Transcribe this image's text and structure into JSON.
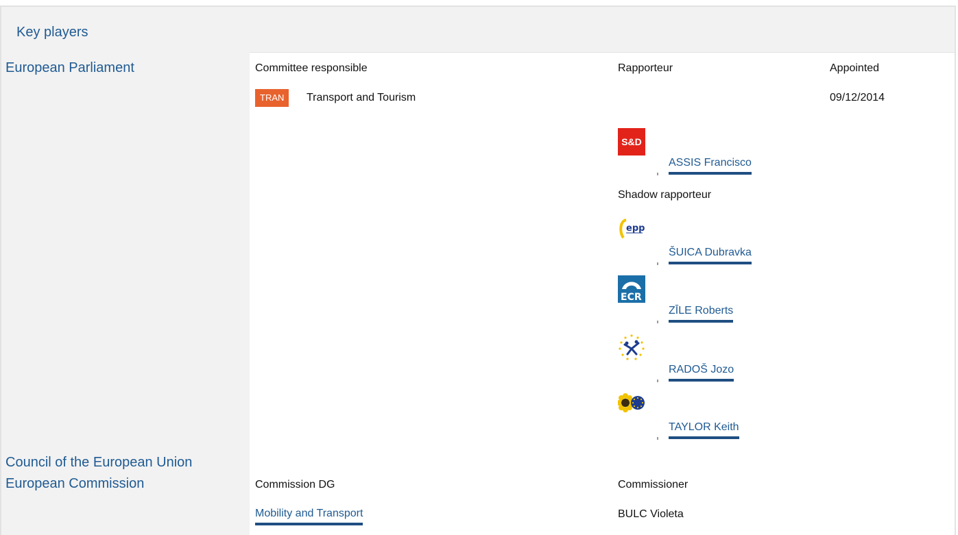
{
  "section": {
    "title": "Key players"
  },
  "institutions": {
    "parliament": "European Parliament",
    "council": "Council of the European Union",
    "commission": "European Commission"
  },
  "parliament": {
    "committee_header": "Committee responsible",
    "rapporteur_header": "Rapporteur",
    "appointed_header": "Appointed",
    "committee_badge": "TRAN",
    "committee_name": "Transport and Tourism",
    "appointed_date": "09/12/2014",
    "rapporteur": {
      "name": "ASSIS Francisco",
      "group_logo_text": "S&D"
    },
    "shadow_header": "Shadow rapporteur",
    "shadows": [
      {
        "name": "ŠUICA Dubravka",
        "group_logo_text": "epp"
      },
      {
        "name": "ZĪLE Roberts",
        "group_logo_text": "ECR"
      },
      {
        "name": "RADOŠ Jozo",
        "group_logo_text": ""
      },
      {
        "name": "TAYLOR Keith",
        "group_logo_text": ""
      }
    ]
  },
  "commission": {
    "dg_header": "Commission DG",
    "commissioner_header": "Commissioner",
    "dg_name": "Mobility and Transport",
    "commissioner_name": "BULC Violeta"
  },
  "colors": {
    "link": "#1f5a92",
    "underline": "#1f4e82",
    "badge": "#e8622e",
    "sd_red": "#e2231a",
    "ecr_blue": "#1b6fa8",
    "panel_bg": "#f2f2f2"
  }
}
